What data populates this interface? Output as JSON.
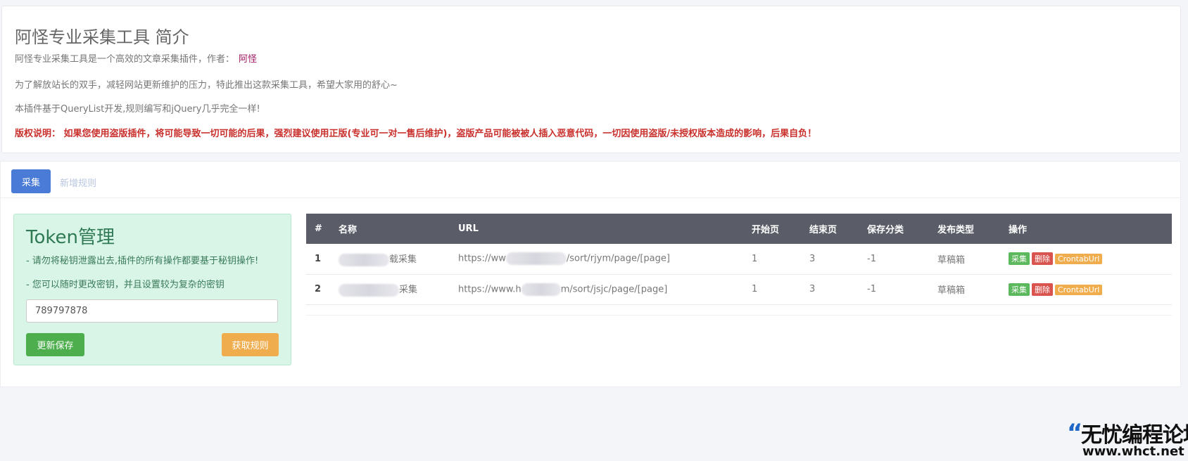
{
  "intro": {
    "title": "阿怪专业采集工具 简介",
    "line1": "阿怪专业采集工具是一个高效的文章采集插件，作者：",
    "author": "阿怪",
    "line2": "为了解放站长的双手，减轻网站更新维护的压力，特此推出这款采集工具，希望大家用的舒心~",
    "line3": "本插件基于QueryList开发,规则编写和jQuery几乎完全一样!",
    "copyright": "版权说明： 如果您使用盗版插件，将可能导致一切可能的后果，强烈建议使用正版(专业可一对一售后维护)，盗版产品可能被被人插入恶意代码，一切因使用盗版/未授权版本造成的影响，后果自负！"
  },
  "tabs": {
    "active": "采集",
    "inactive": "新增规则"
  },
  "token": {
    "title": "Token管理",
    "note1": "- 请勿将秘钥泄露出去,插件的所有操作都要基于秘钥操作!",
    "note2": "- 您可以随时更改密钥，并且设置较为复杂的密钥",
    "value": "789797878",
    "save_label": "更新保存",
    "fetch_label": "获取规则"
  },
  "table": {
    "headers": [
      "#",
      "名称",
      "URL",
      "开始页",
      "结束页",
      "保存分类",
      "发布类型",
      "操作"
    ],
    "rows": [
      {
        "idx": "1",
        "name_suffix": "载采集",
        "url_prefix": "https://ww",
        "url_suffix": "/sort/rjym/page/[page]",
        "start": "1",
        "end": "3",
        "category": "-1",
        "type": "草稿箱"
      },
      {
        "idx": "2",
        "name_suffix": "采集",
        "url_prefix": "https://www.h",
        "url_suffix": "m/sort/jsjc/page/[page]",
        "start": "1",
        "end": "3",
        "category": "-1",
        "type": "草稿箱"
      }
    ],
    "actions": {
      "collect": "采集",
      "delete": "删除",
      "cron": "CrontabUrl"
    }
  },
  "watermark": {
    "text": "无忧编程论坛",
    "url": "www.whct.net"
  }
}
